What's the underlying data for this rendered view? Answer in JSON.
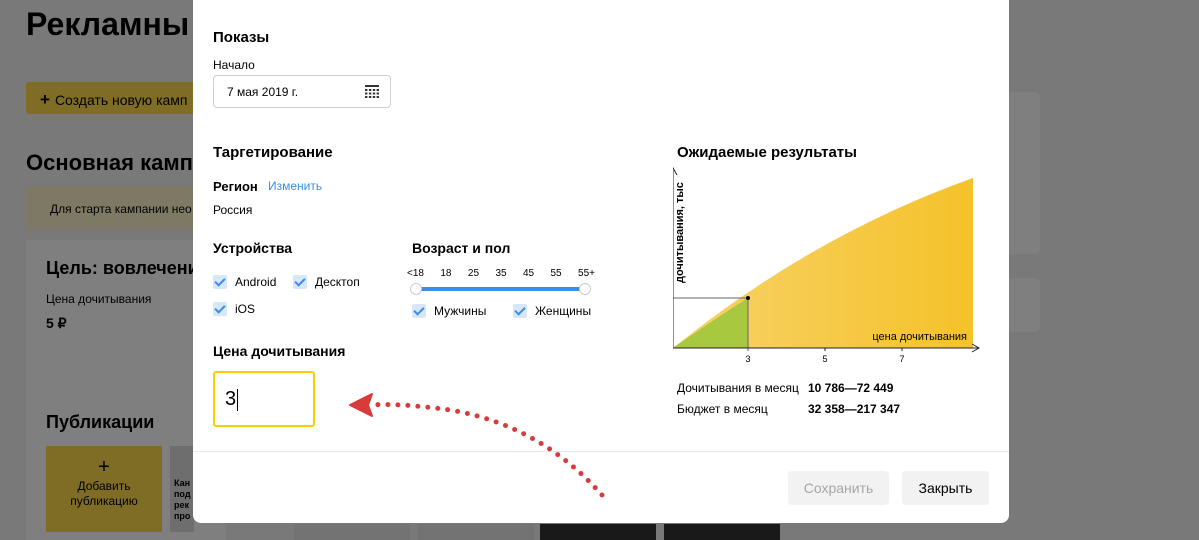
{
  "background": {
    "page_title": "Рекламны",
    "create_button": "Создать новую камп",
    "campaign_title": "Основная кампа",
    "notice": "Для старта кампании нео",
    "goal": "Цель: вовлечени",
    "price_label": "Цена дочитывания",
    "price_value": "5 ₽",
    "publications_title": "Публикации",
    "add_publication": "Добавить публикацию",
    "thumb_text": "Кан под рек про"
  },
  "modal": {
    "impressions": {
      "title": "Показы",
      "start_label": "Начало",
      "start_date": "7 мая 2019 г."
    },
    "targeting": {
      "title": "Таргетирование",
      "region_label": "Регион",
      "region_change": "Изменить",
      "region_value": "Россия",
      "devices_title": "Устройства",
      "devices": [
        "Android",
        "Десктоп",
        "iOS"
      ],
      "age_gender_title": "Возраст и пол",
      "age_ticks": [
        "<18",
        "18",
        "25",
        "35",
        "45",
        "55",
        "55+"
      ],
      "genders": [
        "Мужчины",
        "Женщины"
      ]
    },
    "price": {
      "title": "Цена дочитывания",
      "value": "3"
    },
    "results": {
      "title": "Ожидаемые результаты",
      "reads_label": "Дочитывания в месяц",
      "reads_value": "10 786—72 449",
      "budget_label": "Бюджет в месяц",
      "budget_value": "32 358—217 347"
    },
    "buttons": {
      "save": "Сохранить",
      "close": "Закрыть"
    }
  },
  "chart_data": {
    "type": "area",
    "ylabel": "дочитывания, тыс",
    "xlabel": "цена дочитывания",
    "x_ticks": [
      "3",
      "5",
      "7"
    ],
    "marker_x": 3,
    "colors": {
      "highlight": "#a8c840",
      "area": "#f5c842"
    }
  },
  "colors": {
    "accent": "#ffdb4d",
    "link": "#3a8ee6",
    "focus_border": "#ffcc00",
    "arrow": "#d93b3b"
  }
}
